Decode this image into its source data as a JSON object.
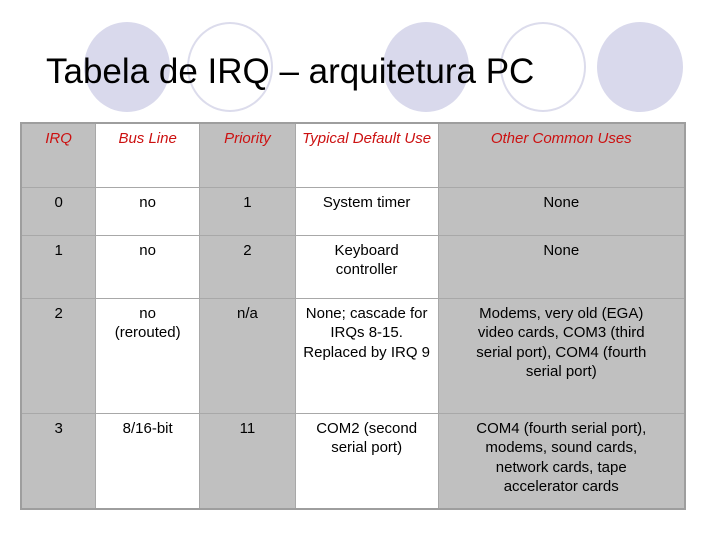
{
  "slide": {
    "title": "Tabela de IRQ – arquitetura PC",
    "colors": {
      "header_text": "#cc1111",
      "gray_column": "#c0c0c0",
      "decor_circle": "#d9d9ec"
    },
    "decorations": [
      "filled-circle",
      "outline-circle",
      "filled-circle",
      "outline-circle",
      "filled-circle"
    ]
  },
  "table": {
    "headers": [
      "IRQ",
      "Bus Line",
      "Priority",
      "Typical Default Use",
      "Other Common Uses"
    ],
    "rows": [
      [
        "0",
        "no",
        "1",
        "System timer",
        "None"
      ],
      [
        "1",
        "no",
        "2",
        "Keyboard controller",
        "None"
      ],
      [
        "2",
        "no (rerouted)",
        "n/a",
        "None; cascade for IRQs 8-15. Replaced by IRQ 9",
        "Modems, very old (EGA) video cards, COM3 (third serial port), COM4 (fourth serial port)"
      ],
      [
        "3",
        "8/16-bit",
        "11",
        "COM2 (second serial port)",
        "COM4 (fourth serial port), modems, sound cards, network cards, tape accelerator cards"
      ]
    ]
  }
}
